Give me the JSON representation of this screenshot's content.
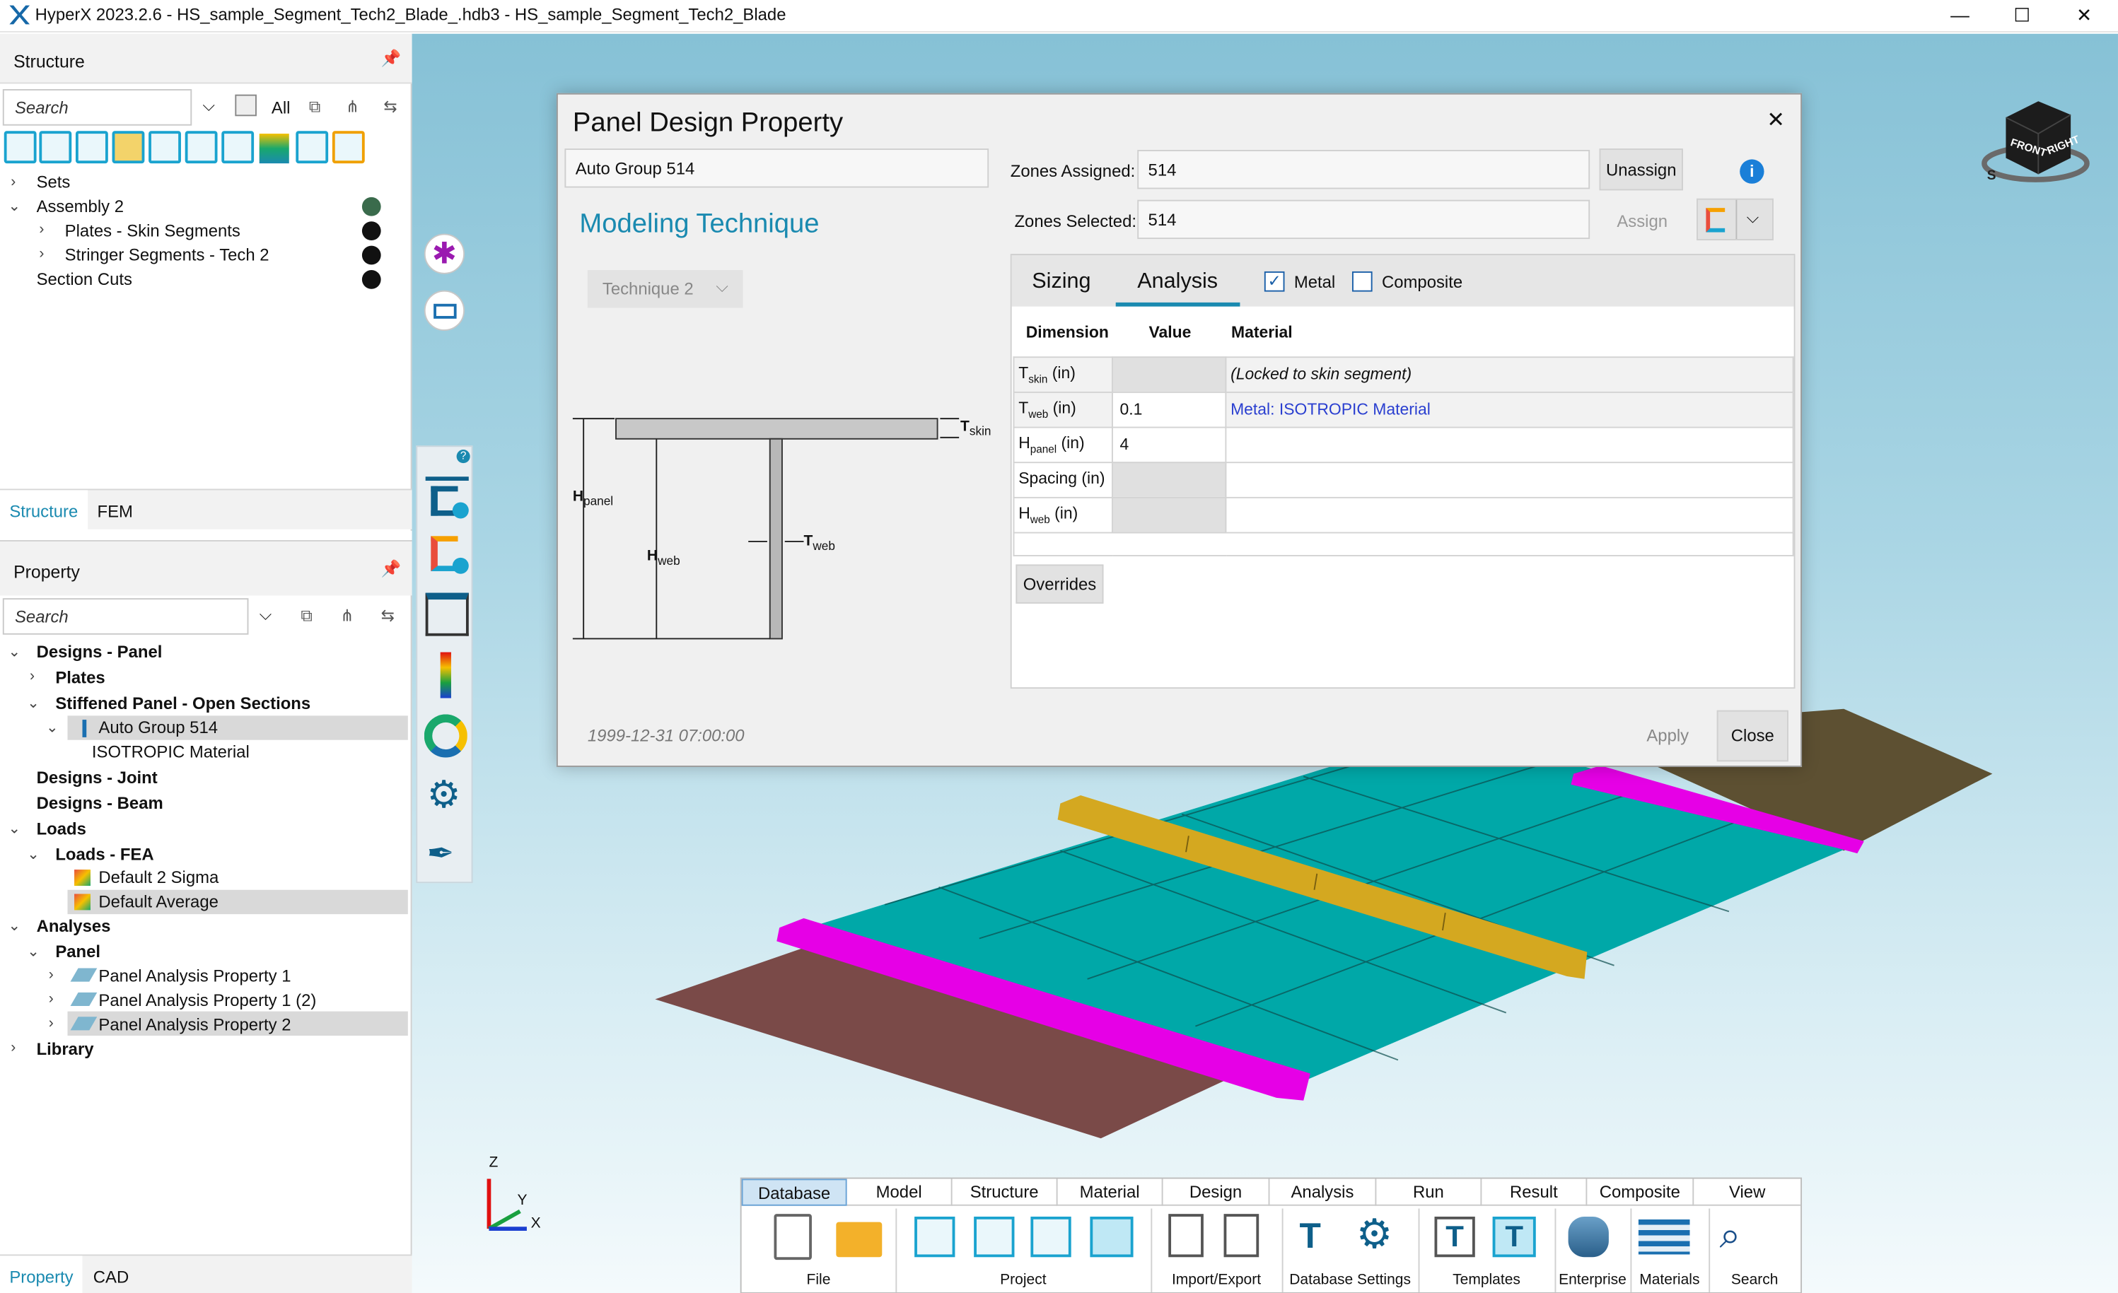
{
  "app": {
    "title": "HyperX 2023.2.6 - HS_sample_Segment_Tech2_Blade_.hdb3 - HS_sample_Segment_Tech2_Blade",
    "minimize": "—",
    "maximize": "☐",
    "close": "✕"
  },
  "structure_panel": {
    "header": "Structure",
    "search_placeholder": "Search",
    "filter_label": "All",
    "tree": [
      {
        "label": "Sets"
      },
      {
        "label": "Assembly 2",
        "dot": "#3a6b4c"
      },
      {
        "label": "Plates - Skin Segments",
        "dot": "#111111"
      },
      {
        "label": "Stringer Segments - Tech 2",
        "dot": "#111111"
      },
      {
        "label": "Section Cuts",
        "dot": "#111111"
      }
    ],
    "tabs": [
      "Structure",
      "FEM"
    ]
  },
  "property_panel": {
    "header": "Property",
    "search_placeholder": "Search",
    "tree": [
      {
        "label": "Designs - Panel"
      },
      {
        "label": "Plates"
      },
      {
        "label": "Stiffened Panel - Open Sections"
      },
      {
        "label": "Auto Group 514"
      },
      {
        "label": "ISOTROPIC Material"
      },
      {
        "label": "Designs - Joint"
      },
      {
        "label": "Designs - Beam"
      },
      {
        "label": "Loads"
      },
      {
        "label": "Loads - FEA"
      },
      {
        "label": "Default 2 Sigma"
      },
      {
        "label": "Default Average"
      },
      {
        "label": "Analyses"
      },
      {
        "label": "Panel"
      },
      {
        "label": "Panel Analysis Property 1"
      },
      {
        "label": "Panel Analysis Property 1 (2)"
      },
      {
        "label": "Panel Analysis Property 2"
      },
      {
        "label": "Library"
      }
    ],
    "tabs": [
      "Property",
      "CAD"
    ]
  },
  "dialog": {
    "title": "Panel Design Property",
    "name_value": "Auto Group 514",
    "modeling_technique_heading": "Modeling Technique",
    "technique_value": "Technique 2",
    "zones_assigned_label": "Zones Assigned:",
    "zones_assigned_value": "514",
    "zones_selected_label": "Zones Selected:",
    "zones_selected_value": "514",
    "unassign": "Unassign",
    "assign": "Assign",
    "tabs": [
      "Sizing",
      "Analysis"
    ],
    "metal_label": "Metal",
    "composite_label": "Composite",
    "table_headers": [
      "Dimension",
      "Value",
      "Material"
    ],
    "rows": [
      {
        "base": "T",
        "sub": "skin",
        "unit": " (in)",
        "value": "",
        "material": "(Locked to skin segment)"
      },
      {
        "base": "T",
        "sub": "web",
        "unit": " (in)",
        "value": "0.1",
        "material": "Metal: ISOTROPIC Material"
      },
      {
        "base": "H",
        "sub": "panel",
        "unit": " (in)",
        "value": "4",
        "material": ""
      },
      {
        "base": "Spacing",
        "sub": "",
        "unit": " (in)",
        "value": "",
        "material": ""
      },
      {
        "base": "H",
        "sub": "web",
        "unit": " (in)",
        "value": "",
        "material": ""
      }
    ],
    "overrides": "Overrides",
    "timestamp": "1999-12-31 07:00:00",
    "apply": "Apply",
    "close": "Close",
    "diagram_labels": {
      "hpanel_base": "H",
      "hpanel_sub": "panel",
      "hweb_base": "H",
      "hweb_sub": "web",
      "tskin_base": "T",
      "tskin_sub": "skin",
      "tweb_base": "T",
      "tweb_sub": "web"
    }
  },
  "viewcube": {
    "front": "FRONT",
    "right": "RIGHT",
    "s": "S"
  },
  "axes": {
    "z": "Z",
    "y": "Y",
    "x": "X"
  },
  "ribbon": {
    "tabs": [
      "Database",
      "Model",
      "Structure",
      "Material",
      "Design",
      "Analysis",
      "Run",
      "Result",
      "Composite",
      "View"
    ],
    "groups": [
      "File",
      "Project",
      "Import/Export",
      "Database Settings",
      "Templates",
      "Enterprise",
      "Materials",
      "Search"
    ]
  },
  "colors": {
    "accent": "#1a8ab0",
    "panel_teal": "#00a8a8",
    "stringer_magenta": "#e600e6",
    "stringer_gold": "#d4a820",
    "skin_brown": "#7a4a48"
  }
}
